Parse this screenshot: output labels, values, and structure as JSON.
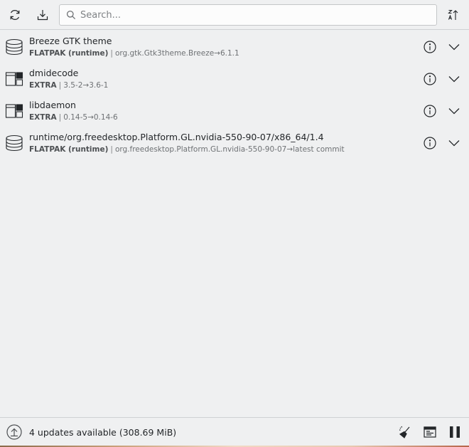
{
  "toolbar": {
    "refresh_icon": "refresh-icon",
    "install_icon": "download-icon",
    "search": {
      "placeholder": "Search...",
      "value": ""
    },
    "sort_icon": "sort-alphabetical-icon"
  },
  "updates": [
    {
      "icon": "package-runtime-icon",
      "name": "Breeze GTK theme",
      "origin": "FLATPAK (runtime)",
      "details": "org.gtk.Gtk3theme.Breeze",
      "arrow": "→",
      "to": "6.1.1"
    },
    {
      "icon": "application-window-icon",
      "name": "dmidecode",
      "origin": "EXTRA",
      "details": "3.5-2",
      "arrow": "→",
      "to": "3.6-1"
    },
    {
      "icon": "application-window-icon",
      "name": "libdaemon",
      "origin": "EXTRA",
      "details": "0.14-5",
      "arrow": "→",
      "to": "0.14-6"
    },
    {
      "icon": "package-runtime-icon",
      "name": "runtime/org.freedesktop.Platform.GL.nvidia-550-90-07/x86_64/1.4",
      "origin": "FLATPAK (runtime)",
      "details": "org.freedesktop.Platform.GL.nvidia-550-90-07",
      "arrow": "→",
      "to": "latest commit"
    }
  ],
  "status": {
    "text": "4 updates available (308.69 MiB)",
    "icons": [
      "clean-icon",
      "console-log-icon",
      "pause-icon"
    ]
  },
  "colors": {
    "background": "#eff0f1",
    "text": "#232629",
    "muted": "#6e7174"
  }
}
